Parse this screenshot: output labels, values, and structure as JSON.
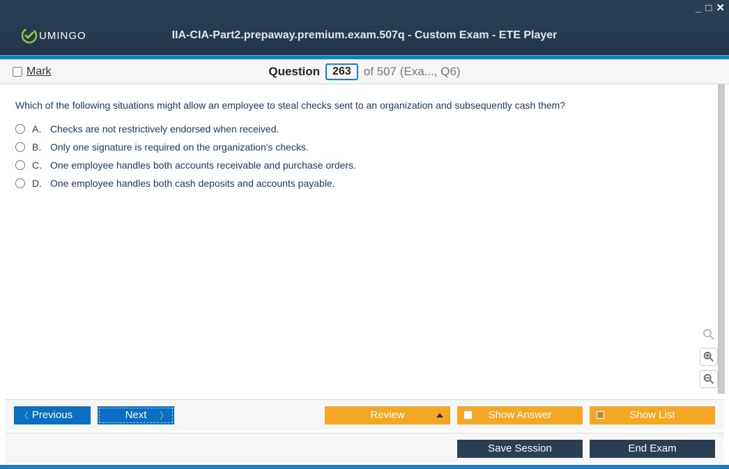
{
  "window": {
    "title": "IIA-CIA-Part2.prepaway.premium.exam.507q - Custom Exam - ETE Player"
  },
  "logo": {
    "text": "UMINGO"
  },
  "subheader": {
    "mark_label": "Mark",
    "question_word": "Question",
    "question_num": "263",
    "question_rest": "of 507 (Exa..., Q6)"
  },
  "question": {
    "text": "Which of the following situations might allow an employee to steal checks sent to an organization and subsequently cash them?",
    "options": [
      {
        "letter": "A.",
        "text": "Checks are not restrictively endorsed when received."
      },
      {
        "letter": "B.",
        "text": "Only one signature is required on the organization's checks."
      },
      {
        "letter": "C.",
        "text": "One employee handles both accounts receivable and purchase orders."
      },
      {
        "letter": "D.",
        "text": "One employee handles both cash deposits and accounts payable."
      }
    ]
  },
  "buttons": {
    "previous": "Previous",
    "next": "Next",
    "review": "Review",
    "show_answer": "Show Answer",
    "show_list": "Show List",
    "save_session": "Save Session",
    "end_exam": "End Exam"
  }
}
